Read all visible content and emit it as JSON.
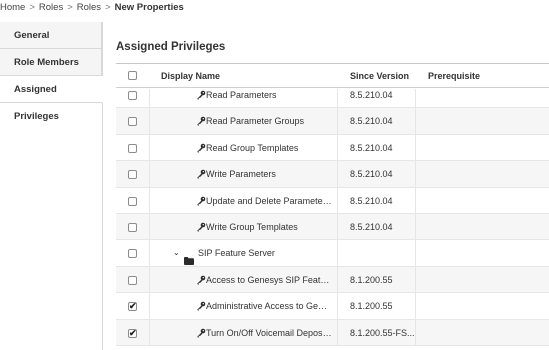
{
  "breadcrumb": [
    "Home",
    "Roles",
    "Roles"
  ],
  "breadcrumb_current": "New Properties",
  "breadcrumb_sep": ">",
  "sidebar": {
    "items": [
      {
        "label": "General"
      },
      {
        "label": "Role Members"
      },
      {
        "label": "Assigned Privileges"
      }
    ]
  },
  "main": {
    "title": "Assigned Privileges",
    "columns": {
      "name": "Display Name",
      "version": "Since Version",
      "prereq": "Prerequisite"
    },
    "rows": [
      {
        "name": "Read Parameters",
        "version": "8.5.210.04",
        "checked": false,
        "type": "privilege"
      },
      {
        "name": "Read Parameter Groups",
        "version": "8.5.210.04",
        "checked": false,
        "type": "privilege"
      },
      {
        "name": "Read Group Templates",
        "version": "8.5.210.04",
        "checked": false,
        "type": "privilege"
      },
      {
        "name": "Write Parameters",
        "version": "8.5.210.04",
        "checked": false,
        "type": "privilege"
      },
      {
        "name": "Update and Delete Parameter Gro...",
        "version": "8.5.210.04",
        "checked": false,
        "type": "privilege"
      },
      {
        "name": "Write Group Templates",
        "version": "8.5.210.04",
        "checked": false,
        "type": "privilege"
      },
      {
        "name": "SIP Feature Server",
        "version": "",
        "checked": false,
        "type": "folder"
      },
      {
        "name": "Access to Genesys SIP Feature Se...",
        "version": "8.1.200.55",
        "checked": false,
        "type": "privilege"
      },
      {
        "name": "Administrative Access to Genesys...",
        "version": "8.1.200.55",
        "checked": true,
        "type": "privilege"
      },
      {
        "name": "Turn On/Off Voicemail Deposits fo...",
        "version": "8.1.200.55-FS...",
        "checked": true,
        "type": "privilege"
      }
    ]
  },
  "colors": {
    "border": "#d8d8d8",
    "row_alt": "#f6f6f6",
    "text": "#333333"
  },
  "icons": {
    "privilege": "key-icon",
    "folder": "folder-icon",
    "expand": "chevron-down-icon",
    "checked": "checkmark-icon"
  }
}
